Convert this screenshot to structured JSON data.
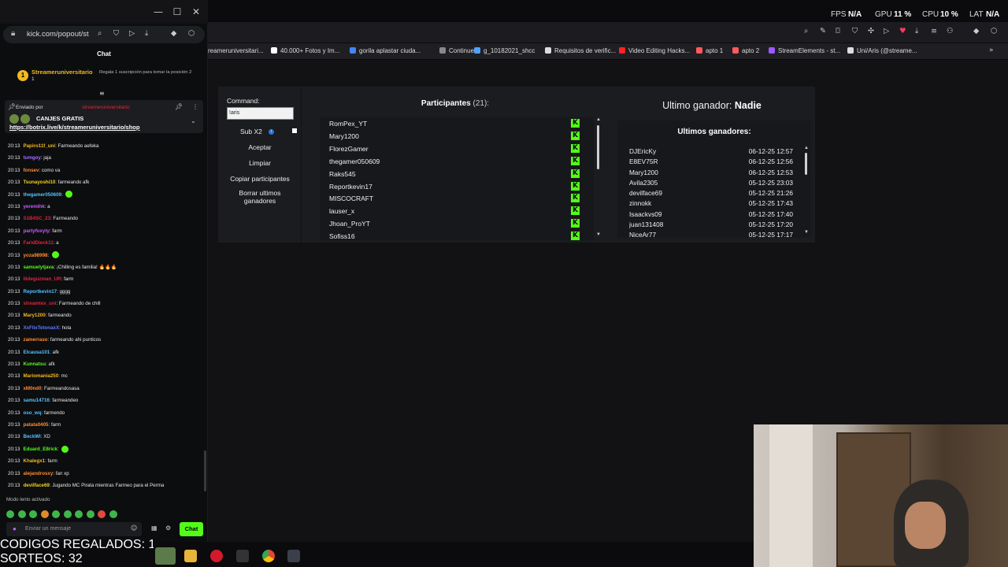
{
  "chat_window": {
    "url": "kick.com/popout/st",
    "header_title": "Chat",
    "sub_gift": {
      "rank": "1",
      "username": "Streameruniversitario",
      "count": "1",
      "hint": "Regala 1 suscripción para tomar la posición 2"
    },
    "pinned": {
      "sent_by": "Enviado por",
      "sender": "streameruniversitario",
      "title": "CANJES GRATIS",
      "link": "https://botrix.live/k/streameruniversitario/shop"
    },
    "messages": [
      {
        "time": "20:13",
        "user": "Papiro11f_uni",
        "color": "#f2b91f",
        "text": "Farmeando aefeka"
      },
      {
        "time": "20:13",
        "user": "tumgoy",
        "color": "#a070ff",
        "text": "jaja"
      },
      {
        "time": "20:13",
        "user": "fonsev",
        "color": "#ff8c30",
        "text": "como va"
      },
      {
        "time": "20:13",
        "user": "Tsunayoshi10",
        "color": "#f2d21b",
        "text": "farmeando afk"
      },
      {
        "time": "20:13",
        "user": "thegamer050609",
        "color": "#53c2ff",
        "text": ""
      },
      {
        "time": "20:13",
        "user": "yeremihk",
        "color": "#c85cff",
        "text": "a"
      },
      {
        "time": "20:13",
        "user": "S1B4SC_23",
        "color": "#e0253c",
        "text": "Farmeando"
      },
      {
        "time": "20:13",
        "user": "partyfoxyty",
        "color": "#c85cff",
        "text": "farm"
      },
      {
        "time": "20:13",
        "user": "FaridDieck11",
        "color": "#e0253c",
        "text": "a"
      },
      {
        "time": "20:13",
        "user": "yoza98998",
        "color": "#ff8c30",
        "text": ""
      },
      {
        "time": "20:13",
        "user": "samuelytjava",
        "color": "#53fc18",
        "text": "¡Chilling es familia! 🔥🔥🔥"
      },
      {
        "time": "20:13",
        "user": "lildeguzman_UR",
        "color": "#e0253c",
        "text": "farm"
      },
      {
        "time": "20:13",
        "user": "Reportkevin17",
        "color": "#53c2ff",
        "text": "gggg"
      },
      {
        "time": "20:13",
        "user": "streamtex_uni",
        "color": "#e0253c",
        "text": "Farmeando de chill"
      },
      {
        "time": "20:13",
        "user": "Mary1200",
        "color": "#f2b91f",
        "text": "farmeando"
      },
      {
        "time": "20:13",
        "user": "XxFlixTetonaxX",
        "color": "#5b7cff",
        "text": "hola"
      },
      {
        "time": "20:13",
        "user": "zamerraso",
        "color": "#ff8c30",
        "text": "farmeando ahi punticos"
      },
      {
        "time": "20:13",
        "user": "Elcausa101",
        "color": "#53c2ff",
        "text": "afk"
      },
      {
        "time": "20:13",
        "user": "Kunnatsu",
        "color": "#53fc18",
        "text": "afk"
      },
      {
        "time": "20:13",
        "user": "Mariomania250",
        "color": "#f2b91f",
        "text": "mc"
      },
      {
        "time": "20:13",
        "user": "xM0nd0",
        "color": "#ff8c30",
        "text": "Farmeandosasa"
      },
      {
        "time": "20:13",
        "user": "samu14716",
        "color": "#53c2ff",
        "text": "farmeandeo"
      },
      {
        "time": "20:13",
        "user": "oso_wq",
        "color": "#53c2ff",
        "text": "farmendo"
      },
      {
        "time": "20:13",
        "user": "patata0405",
        "color": "#ff8c30",
        "text": "farm"
      },
      {
        "time": "20:13",
        "user": "BeckWi",
        "color": "#53c2ff",
        "text": "XD"
      },
      {
        "time": "20:13",
        "user": "Eduard_E8rick",
        "color": "#53fc18",
        "text": ""
      },
      {
        "time": "20:13",
        "user": "Khalegx1",
        "color": "#f2b91f",
        "text": "farm"
      },
      {
        "time": "20:13",
        "user": "alejandrosxy",
        "color": "#ff8c30",
        "text": "fan xp"
      },
      {
        "time": "20:13",
        "user": "devilface69",
        "color": "#f2d21b",
        "text": "Jugando MC Pirata mientras Farmeo para el Perma"
      }
    ],
    "slow_mode": "Modo lento activado",
    "input_placeholder": "Enviar un mensaje",
    "send_label": "Chat"
  },
  "overlay": {
    "codes": "CODIGOS REGALADOS: 1",
    "draws": "SORTEOS: 32"
  },
  "perf": {
    "fps_label": "FPS",
    "fps": "N/A",
    "gpu_label": "GPU",
    "gpu": "11 %",
    "cpu_label": "CPU",
    "cpu": "10 %",
    "lat_label": "LAT",
    "lat": "N/A"
  },
  "bookmarks": [
    {
      "label": "reameruniversitari...",
      "color": "#53fc18"
    },
    {
      "label": "40.000+ Fotos y Im...",
      "color": "#ffffff"
    },
    {
      "label": "gorila aplastar ciuda...",
      "color": "#4285f4"
    },
    {
      "label": "Continue",
      "color": "#888888"
    },
    {
      "label": "g_10182021_shcc",
      "color": "#4fa3ff"
    },
    {
      "label": "Requisitos de verific...",
      "color": "#dddddd"
    },
    {
      "label": "Video Editing Hacks...",
      "color": "#ff2222"
    },
    {
      "label": "apto 1",
      "color": "#ff5a5f"
    },
    {
      "label": "apto 2",
      "color": "#ff5a5f"
    },
    {
      "label": "StreamElements - st...",
      "color": "#9b59ff"
    },
    {
      "label": "Uni/Aris (@streame...",
      "color": "#dddddd"
    }
  ],
  "giveaway": {
    "command_label": "Command:",
    "command_value": "!aris",
    "sub_x2_label": "Sub X2",
    "buttons": [
      "Aceptar",
      "Limpiar",
      "Copiar participantes",
      "Borrar ultimos ganadores"
    ],
    "participants_title": "Participantes",
    "participants_count": "(21):",
    "participants": [
      "RomPex_YT",
      "Mary1200",
      "FlorezGamer",
      "thegamer050609",
      "Raks545",
      "Reportkevin17",
      "MISCOCRAFT",
      "lauser_x",
      "Jhoan_ProYT",
      "Sofiss16"
    ],
    "last_winner_label": "Ultimo ganador:",
    "last_winner": "Nadie",
    "winners_title": "Ultimos ganadores:",
    "winners": [
      {
        "name": "DJEricKy",
        "date": "06-12-25 12:57"
      },
      {
        "name": "E8EV75R",
        "date": "06-12-25 12:56"
      },
      {
        "name": "Mary1200",
        "date": "06-12-25 12:53"
      },
      {
        "name": "Avila2305",
        "date": "05-12-25 23:03"
      },
      {
        "name": "devilface69",
        "date": "05-12-25 21:26"
      },
      {
        "name": "zinnokk",
        "date": "05-12-25 17:43"
      },
      {
        "name": "Isaackvs09",
        "date": "05-12-25 17:40"
      },
      {
        "name": "juan131408",
        "date": "05-12-25 17:20"
      },
      {
        "name": "NiceAr77",
        "date": "05-12-25 17:17"
      }
    ]
  },
  "colors": {
    "kick_green": "#53fc18",
    "gold": "#f2b91f"
  }
}
